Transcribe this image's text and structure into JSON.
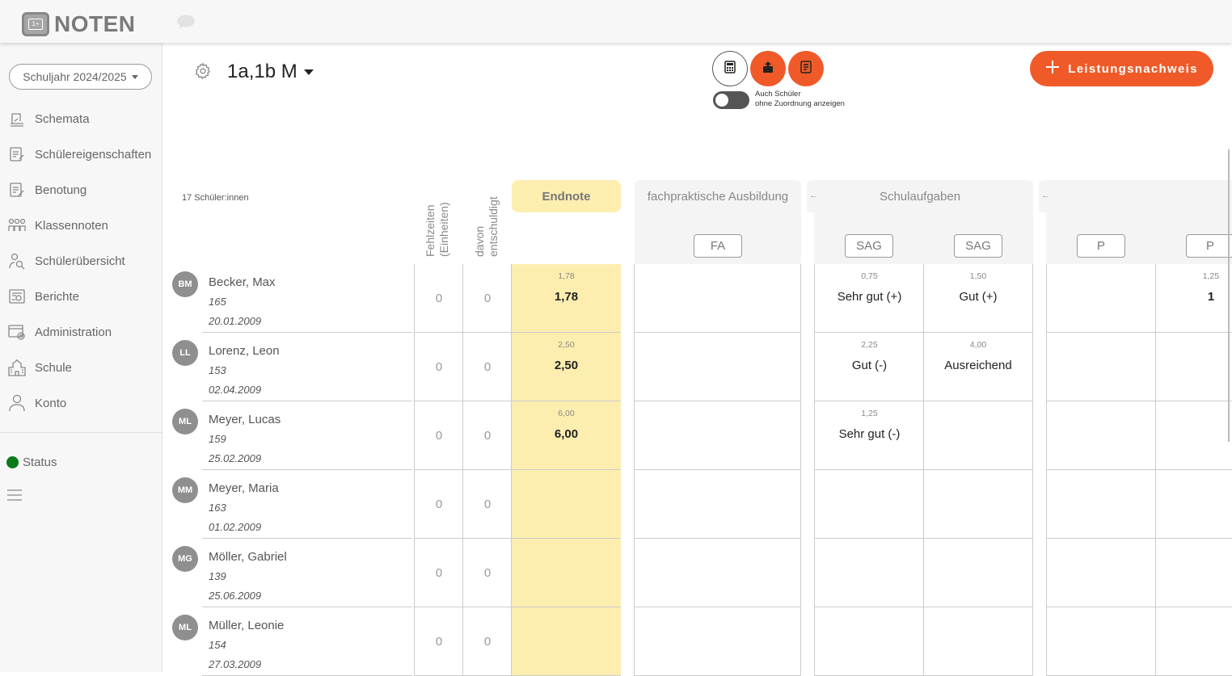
{
  "app": {
    "name": "NOTEN",
    "logo_badge": "1+"
  },
  "sidebar": {
    "school_year": "Schuljahr 2024/2025",
    "items": [
      {
        "label": "Schemata",
        "icon": "schema-icon"
      },
      {
        "label": "Schülereigenschaften",
        "icon": "student-properties-icon"
      },
      {
        "label": "Benotung",
        "icon": "grading-icon"
      },
      {
        "label": "Klassennoten",
        "icon": "class-grades-icon"
      },
      {
        "label": "Schülerübersicht",
        "icon": "student-overview-icon"
      },
      {
        "label": "Berichte",
        "icon": "reports-icon"
      },
      {
        "label": "Administration",
        "icon": "administration-icon"
      },
      {
        "label": "Schule",
        "icon": "school-icon"
      },
      {
        "label": "Konto",
        "icon": "account-icon"
      }
    ],
    "status": "Status",
    "status_color": "#0a7a1a"
  },
  "header": {
    "class_title": "1a,1b M",
    "toggle_label_1": "Auch Schüler",
    "toggle_label_2": "ohne Zuordnung anzeigen",
    "add_button": "Leistungsnachweis",
    "accent": "#f05a28"
  },
  "grid": {
    "student_count": "17 Schüler:innen",
    "col_absence": "Fehlzeiten (Einheiten)",
    "col_absence_line1": "Fehlzeiten",
    "col_absence_line2": "(Einheiten)",
    "col_excused_line1": "davon",
    "col_excused_line2": "entschuldigt",
    "col_final": "Endnote",
    "groups": [
      {
        "title": "fachpraktische Ausbildung",
        "subs": [
          "FA"
        ]
      },
      {
        "title": "Schulaufgaben",
        "subs": [
          "SAG",
          "SAG"
        ]
      },
      {
        "title": "",
        "subs": [
          "P",
          "P"
        ]
      }
    ]
  },
  "students": [
    {
      "initials": "BM",
      "name": "Becker, Max",
      "id": "165",
      "dob": "20.01.2009",
      "abs": "0",
      "exc": "0",
      "final_small": "1,78",
      "final": "1,78",
      "sag1_small": "0,75",
      "sag1": "Sehr gut (+)",
      "sag2_small": "1,50",
      "sag2": "Gut (+)",
      "p2_small": "1,25",
      "p2": "1"
    },
    {
      "initials": "LL",
      "name": "Lorenz, Leon",
      "id": "153",
      "dob": "02.04.2009",
      "abs": "0",
      "exc": "0",
      "final_small": "2,50",
      "final": "2,50",
      "sag1_small": "2,25",
      "sag1": "Gut (-)",
      "sag2_small": "4,00",
      "sag2": "Ausreichend",
      "p2_small": "",
      "p2": ""
    },
    {
      "initials": "ML",
      "name": "Meyer, Lucas",
      "id": "159",
      "dob": "25.02.2009",
      "abs": "0",
      "exc": "0",
      "final_small": "6,00",
      "final": "6,00",
      "sag1_small": "1,25",
      "sag1": "Sehr gut (-)",
      "sag2_small": "",
      "sag2": "",
      "p2_small": "",
      "p2": ""
    },
    {
      "initials": "MM",
      "name": "Meyer, Maria",
      "id": "163",
      "dob": "01.02.2009",
      "abs": "0",
      "exc": "0",
      "final_small": "",
      "final": "",
      "sag1_small": "",
      "sag1": "",
      "sag2_small": "",
      "sag2": "",
      "p2_small": "",
      "p2": ""
    },
    {
      "initials": "MG",
      "name": "Möller, Gabriel",
      "id": "139",
      "dob": "25.06.2009",
      "abs": "0",
      "exc": "0",
      "final_small": "",
      "final": "",
      "sag1_small": "",
      "sag1": "",
      "sag2_small": "",
      "sag2": "",
      "p2_small": "",
      "p2": ""
    },
    {
      "initials": "ML",
      "name": "Müller, Leonie",
      "id": "154",
      "dob": "27.03.2009",
      "abs": "0",
      "exc": "0",
      "final_small": "",
      "final": "",
      "sag1_small": "",
      "sag1": "",
      "sag2_small": "",
      "sag2": "",
      "p2_small": "",
      "p2": ""
    }
  ]
}
